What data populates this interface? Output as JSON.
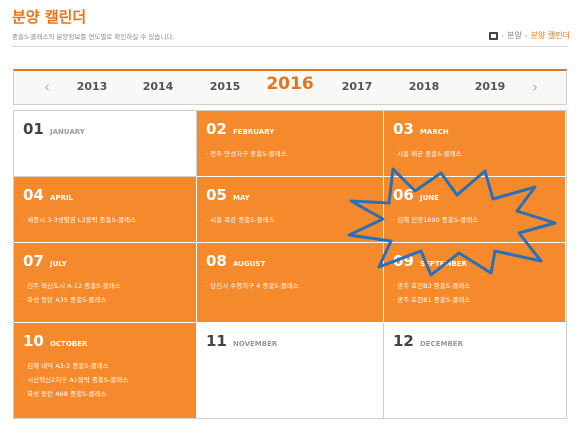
{
  "header": {
    "title": "분양 캘린더",
    "subtitle": "중흥S-클래스의 분양정보를 연도별로 확인하실 수 있습니다.",
    "breadcrumb": [
      "분양",
      "분양 캘린더"
    ]
  },
  "year_nav": {
    "prev_icon": "chevron-left-icon",
    "next_icon": "chevron-right-icon",
    "years": [
      "2013",
      "2014",
      "2015",
      "2016",
      "2017",
      "2018",
      "2019"
    ],
    "current": "2016"
  },
  "months": [
    {
      "num": "01",
      "name": "JANUARY",
      "events": []
    },
    {
      "num": "02",
      "name": "FEBRUARY",
      "events": [
        "전주 만성지구 중흥S-클래스"
      ]
    },
    {
      "num": "03",
      "name": "MARCH",
      "events": [
        "시흥 배곧 중흥S-클래스"
      ]
    },
    {
      "num": "04",
      "name": "APRIL",
      "events": [
        "세종시 3-3생활권 L3블럭 중흥S-클래스"
      ]
    },
    {
      "num": "05",
      "name": "MAY",
      "events": [
        "시흥 목감 중흥S-클래스"
      ]
    },
    {
      "num": "06",
      "name": "JUNE",
      "events": [
        "김해 진영1690 중흥S-클래스"
      ]
    },
    {
      "num": "07",
      "name": "JULY",
      "events": [
        "진주 혁신도시 A-12 중흥S-클래스",
        "화성 동탄 A35 중흥S-클래스"
      ]
    },
    {
      "num": "08",
      "name": "AUGUST",
      "events": [
        "당진시 수청지구 4 중흥S-클래스"
      ]
    },
    {
      "num": "09",
      "name": "SEPTEMBER",
      "events": [
        "광주 효천B3 중흥S-클래스",
        "광주 효천B1 중흥S-클래스"
      ]
    },
    {
      "num": "10",
      "name": "OCTOBER",
      "events": [
        "김해 내덕 A3-2 중흥S-클래스",
        "시산혁신2지구 A1블럭 중흥S-클래스",
        "화성 동탄 A68 중흥S-클래스"
      ]
    },
    {
      "num": "11",
      "name": "NOVEMBER",
      "events": []
    },
    {
      "num": "12",
      "name": "DECEMBER",
      "events": []
    }
  ],
  "colors": {
    "accent": "#e8731a",
    "active_cell": "#f48a2c",
    "burst_outline": "#2a6fb8"
  }
}
